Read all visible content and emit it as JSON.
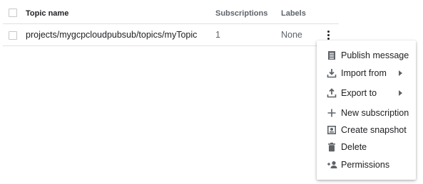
{
  "table": {
    "headers": {
      "topic_name": "Topic name",
      "subscriptions": "Subscriptions",
      "labels": "Labels"
    },
    "rows": [
      {
        "topic_name": "projects/mygcpcloudpubsub/topics/myTopic",
        "subscriptions": "1",
        "labels": "None"
      }
    ]
  },
  "menu": {
    "items": [
      {
        "label": "Publish message",
        "icon": "publish-icon"
      },
      {
        "label": "Import from",
        "icon": "import-icon",
        "submenu": true
      },
      {
        "label": "Export to",
        "icon": "export-icon",
        "submenu": true
      },
      {
        "label": "New subscription",
        "icon": "plus-icon"
      },
      {
        "label": "Create snapshot",
        "icon": "snapshot-icon"
      },
      {
        "label": "Delete",
        "icon": "trash-icon"
      },
      {
        "label": "Permissions",
        "icon": "add-person-icon"
      }
    ]
  }
}
